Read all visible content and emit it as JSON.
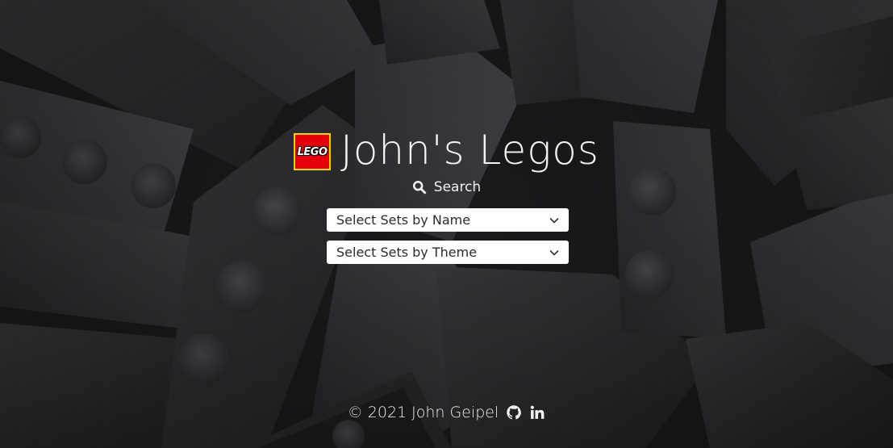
{
  "header": {
    "logo_text": "LEGO",
    "title": "John's Legos"
  },
  "search": {
    "label": "Search",
    "icon": "search-icon"
  },
  "selects": {
    "by_name": "Select Sets by Name",
    "by_theme": "Select Sets by Theme"
  },
  "footer": {
    "copyright": "© 2021 John Geipel",
    "github_icon": "github-icon",
    "linkedin_icon": "linkedin-icon"
  },
  "colors": {
    "logo_red": "#e3000b",
    "logo_yellow": "#f6d500",
    "text_light": "#f3f3f3",
    "select_bg": "#ffffff",
    "select_text": "#2b2b2b"
  }
}
